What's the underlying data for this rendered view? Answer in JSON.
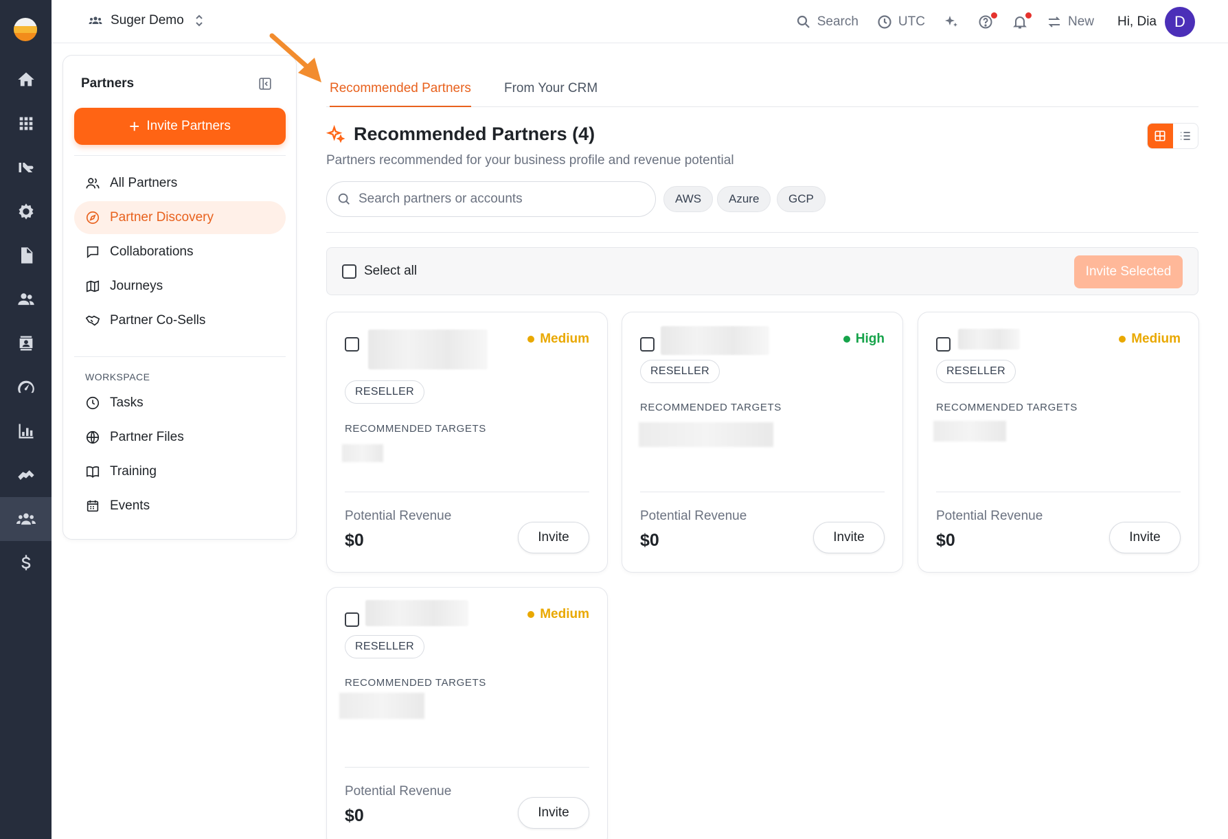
{
  "topbar": {
    "workspace": "Suger Demo",
    "search_label": "Search",
    "tz_label": "UTC",
    "new_label": "New",
    "greeting": "Hi, Dia",
    "avatar_initial": "D"
  },
  "rail": {
    "icons": [
      "home-icon",
      "apps-grid-icon",
      "marketplace-icon",
      "settings-icon",
      "document-icon",
      "people-icon",
      "contacts-icon",
      "speedometer-icon",
      "analytics-icon",
      "handshake-icon",
      "partners-icon",
      "dollar-icon"
    ],
    "active": "partners-icon"
  },
  "sidebar": {
    "title": "Partners",
    "invite_button": "Invite Partners",
    "items": [
      {
        "label": "All Partners",
        "icon": "users-icon"
      },
      {
        "label": "Partner Discovery",
        "icon": "compass-icon",
        "active": true
      },
      {
        "label": "Collaborations",
        "icon": "chat-icon"
      },
      {
        "label": "Journeys",
        "icon": "map-icon"
      },
      {
        "label": "Partner Co-Sells",
        "icon": "handshake-icon"
      }
    ],
    "workspace_label": "WORKSPACE",
    "workspace_items": [
      {
        "label": "Tasks",
        "icon": "clock-icon"
      },
      {
        "label": "Partner Files",
        "icon": "globe-icon"
      },
      {
        "label": "Training",
        "icon": "book-icon"
      },
      {
        "label": "Events",
        "icon": "calendar-icon"
      }
    ]
  },
  "tabs": [
    {
      "label": "Recommended Partners",
      "active": true
    },
    {
      "label": "From Your CRM",
      "active": false
    }
  ],
  "main": {
    "title": "Recommended Partners (4)",
    "subtitle": "Partners recommended for your business profile and revenue potential",
    "search_placeholder": "Search partners or accounts",
    "filters": [
      "AWS",
      "Azure",
      "GCP"
    ],
    "select_all": "Select all",
    "invite_selected": "Invite Selected"
  },
  "colors": {
    "accent": "#ff6414",
    "medium": "#e9a800",
    "high": "#16a34a"
  },
  "cards": [
    {
      "priority": "Medium",
      "type": "RESELLER",
      "targets_label": "RECOMMENDED TARGETS",
      "revenue_label": "Potential Revenue",
      "revenue": "$0",
      "invite": "Invite"
    },
    {
      "priority": "High",
      "type": "RESELLER",
      "targets_label": "RECOMMENDED TARGETS",
      "revenue_label": "Potential Revenue",
      "revenue": "$0",
      "invite": "Invite"
    },
    {
      "priority": "Medium",
      "type": "RESELLER",
      "targets_label": "RECOMMENDED TARGETS",
      "revenue_label": "Potential Revenue",
      "revenue": "$0",
      "invite": "Invite"
    },
    {
      "priority": "Medium",
      "type": "RESELLER",
      "targets_label": "RECOMMENDED TARGETS",
      "revenue_label": "Potential Revenue",
      "revenue": "$0",
      "invite": "Invite"
    }
  ]
}
